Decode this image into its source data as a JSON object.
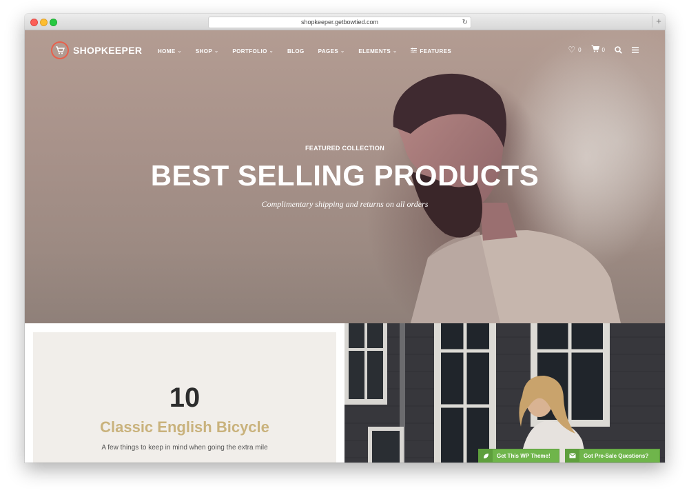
{
  "browser": {
    "url": "shopkeeper.getbowtied.com"
  },
  "header": {
    "logo_text": "SHOPKEEPER",
    "nav": [
      {
        "label": "HOME",
        "has_dropdown": true
      },
      {
        "label": "SHOP",
        "has_dropdown": true
      },
      {
        "label": "PORTFOLIO",
        "has_dropdown": true
      },
      {
        "label": "BLOG",
        "has_dropdown": false
      },
      {
        "label": "PAGES",
        "has_dropdown": true
      },
      {
        "label": "ELEMENTS",
        "has_dropdown": true
      },
      {
        "label": "FEATURES",
        "has_dropdown": false
      }
    ],
    "wishlist_count": "0",
    "cart_count": "0"
  },
  "hero": {
    "eyebrow": "FEATURED COLLECTION",
    "headline": "BEST SELLING PRODUCTS",
    "subtitle": "Complimentary shipping and returns on all orders"
  },
  "feature_card": {
    "number": "10",
    "title": "Classic English Bicycle",
    "subtitle": "A few things to keep in mind when going the extra mile"
  },
  "cta": {
    "get_theme": "Get This WP Theme!",
    "presale": "Got Pre-Sale Questions?"
  },
  "colors": {
    "accent": "#e8604c",
    "gold": "#c9b27c",
    "cta_green": "#6fb54b"
  },
  "icons": [
    "heart-icon",
    "cart-icon",
    "search-icon",
    "menu-icon",
    "features-sliders-icon",
    "leaf-icon",
    "mail-icon"
  ]
}
